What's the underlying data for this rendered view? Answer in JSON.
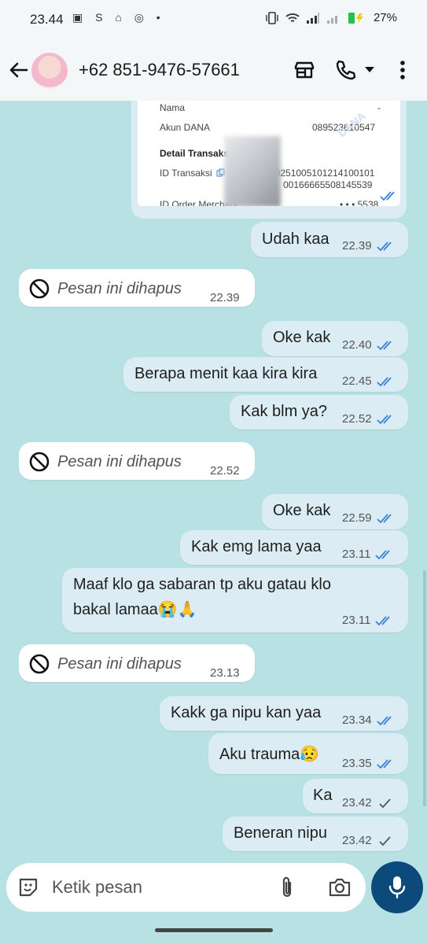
{
  "status": {
    "time": "23.44",
    "left_icons": "▣ S ⌂ ◎ •",
    "battery": "27%"
  },
  "header": {
    "contact": "+62 851-9476-57661"
  },
  "receipt": {
    "nama_label": "Nama",
    "nama_value": "-",
    "akun_label": "Akun DANA",
    "akun_value": "089523610547",
    "detail_title": "Detail Transaksi",
    "id_label": "ID Transaksi",
    "id_value_1": "20251005101214100101",
    "id_value_2": "00166665508145539",
    "order_label": "ID Order Merchant",
    "order_value": "• • • 5538",
    "watermark": "DANA"
  },
  "messages": [
    {
      "text": "Udah kaa",
      "time": "22.39"
    },
    {
      "text": "Pesan ini dihapus",
      "time": "22.39"
    },
    {
      "text": "Oke kak",
      "time": "22.40"
    },
    {
      "text": "Berapa menit kaa kira kira",
      "time": "22.45"
    },
    {
      "text": "Kak blm ya?",
      "time": "22.52"
    },
    {
      "text": "Pesan ini dihapus",
      "time": "22.52"
    },
    {
      "text": "Oke kak",
      "time": "22.59"
    },
    {
      "text": "Kak emg lama yaa",
      "time": "23.11"
    },
    {
      "text": "Maaf klo ga sabaran tp aku gatau klo",
      "text2": "bakal lamaa😭🙏",
      "time": "23.11"
    },
    {
      "text": "Pesan ini dihapus",
      "time": "23.13"
    },
    {
      "text": "Kakk ga nipu kan yaa",
      "time": "23.34"
    },
    {
      "text": "Aku trauma😥",
      "time": "23.35"
    },
    {
      "text": "Ka",
      "time": "23.42"
    },
    {
      "text": "Beneran nipu",
      "time": "23.42"
    }
  ],
  "composer": {
    "placeholder": "Ketik pesan"
  },
  "colors": {
    "read_tick": "#3b82d6",
    "sent_tick": "#555555",
    "mic_bg": "#0b4a7a"
  }
}
